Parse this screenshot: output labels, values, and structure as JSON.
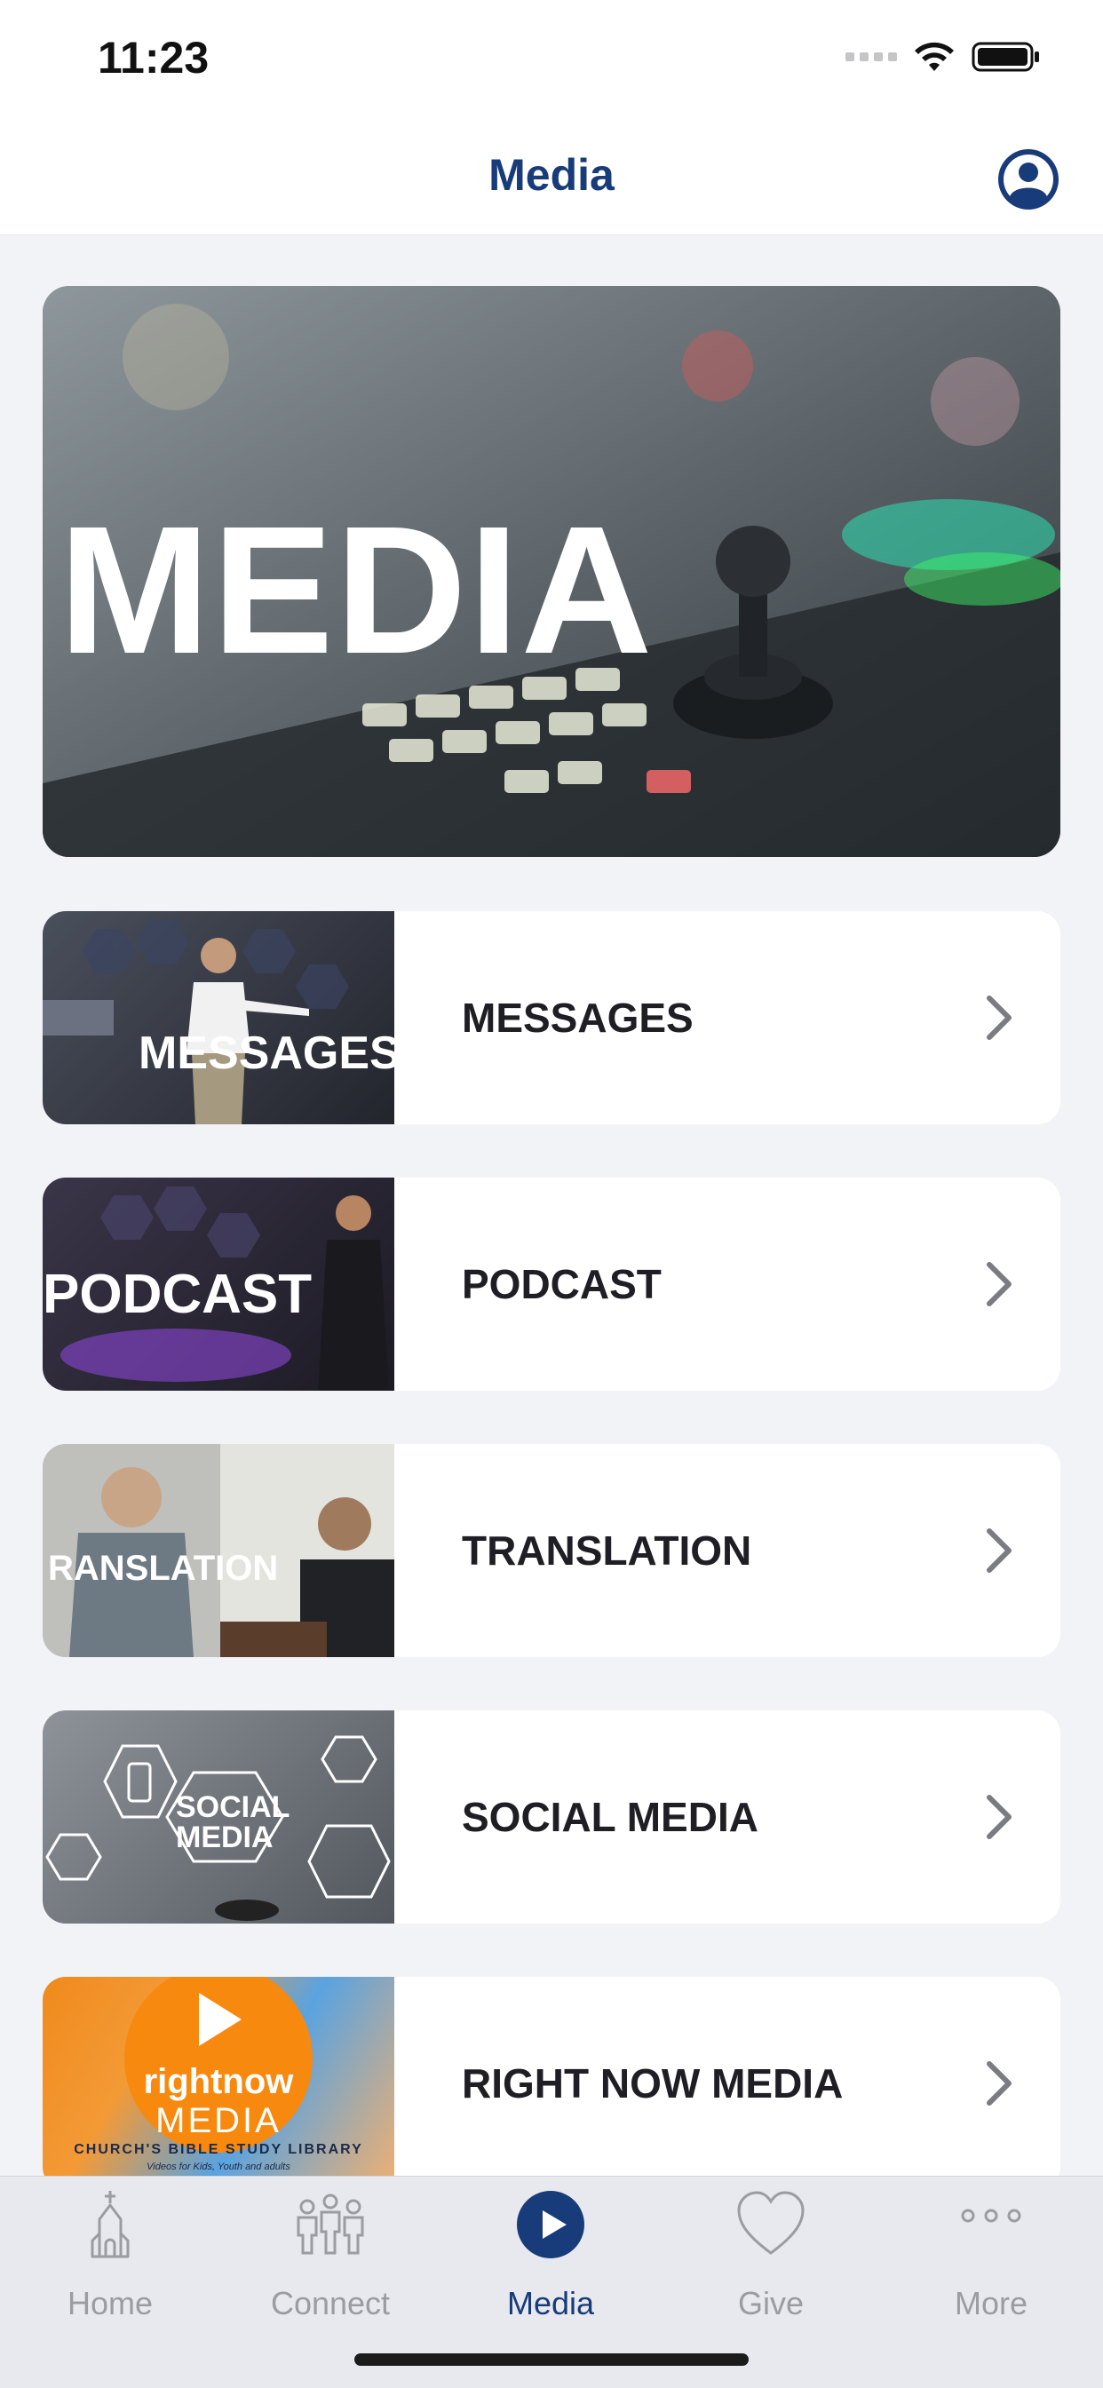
{
  "status_bar": {
    "time": "11:23"
  },
  "header": {
    "title": "Media"
  },
  "hero": {
    "text": "MEDIA"
  },
  "rows": [
    {
      "label": "MESSAGES",
      "thumb_text": "MESSAGES"
    },
    {
      "label": "PODCAST",
      "thumb_text": "PODCAST"
    },
    {
      "label": "TRANSLATION",
      "thumb_text": "RANSLATION"
    },
    {
      "label": "SOCIAL MEDIA",
      "thumb_text": "SOCIAL MEDIA"
    },
    {
      "label": "RIGHT NOW MEDIA",
      "thumb_text_brand": "rightnow",
      "thumb_text_media": "MEDIA",
      "thumb_text_sub": "CHURCH'S BIBLE STUDY LIBRARY",
      "thumb_text_small": "Videos for Kids, Youth and adults"
    }
  ],
  "tabs": [
    {
      "label": "Home",
      "icon": "church-icon",
      "active": false
    },
    {
      "label": "Connect",
      "icon": "people-icon",
      "active": false
    },
    {
      "label": "Media",
      "icon": "play-icon",
      "active": true
    },
    {
      "label": "Give",
      "icon": "heart-icon",
      "active": false
    },
    {
      "label": "More",
      "icon": "more-icon",
      "active": false
    }
  ],
  "colors": {
    "accent": "#183b7a",
    "inactive": "#9a9ca2",
    "background": "#f2f3f7"
  }
}
